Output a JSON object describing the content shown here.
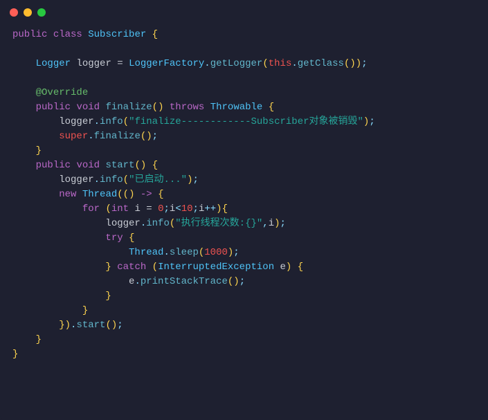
{
  "code": {
    "tokens": {
      "public": "public",
      "class": "class",
      "Subscriber": "Subscriber",
      "Logger": "Logger",
      "logger": "logger",
      "eq": " = ",
      "LoggerFactory": "LoggerFactory",
      "dot": ".",
      "getLogger": "getLogger",
      "this": "this",
      "getClass": "getClass",
      "Override": "@Override",
      "void": "void",
      "finalize": "finalize",
      "throws": "throws",
      "Throwable": "Throwable",
      "info": "info",
      "str_finalize": "\"finalize------------Subscriber对象被销毁\"",
      "super": "super",
      "start": "start",
      "str_started": "\"已启动...\"",
      "new": "new",
      "Thread": "Thread",
      "arrow": " -> ",
      "for": "for",
      "int": "int",
      "i": "i",
      "zero": "0",
      "lt": "<",
      "ten": "10",
      "inc": "++",
      "str_exec": "\"执行线程次数:{}\"",
      "comma": ",",
      "try": "try",
      "sleep": "sleep",
      "thousand": "1000",
      "catch": "catch",
      "InterruptedException": "InterruptedException",
      "e": "e",
      "printStackTrace": "printStackTrace",
      "semi": ";",
      "lbrace": "{",
      "rbrace": "}",
      "lparen": "(",
      "rparen": ")"
    }
  }
}
